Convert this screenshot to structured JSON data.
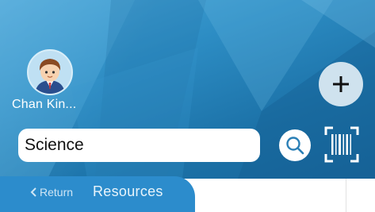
{
  "user": {
    "name": "Chan Kin..."
  },
  "search": {
    "value": "Science"
  },
  "nav": {
    "back_label": "Return",
    "title": "Resources"
  },
  "icons": {
    "add": "plus-icon",
    "search": "magnifier-icon",
    "scan": "barcode-scan-icon",
    "back": "chevron-left-icon"
  },
  "colors": {
    "header_blue": "#2d8dc4",
    "tab_blue": "#2c8ccc",
    "add_button_bg": "#cfe2ee",
    "search_field_bg": "#ffffff"
  }
}
